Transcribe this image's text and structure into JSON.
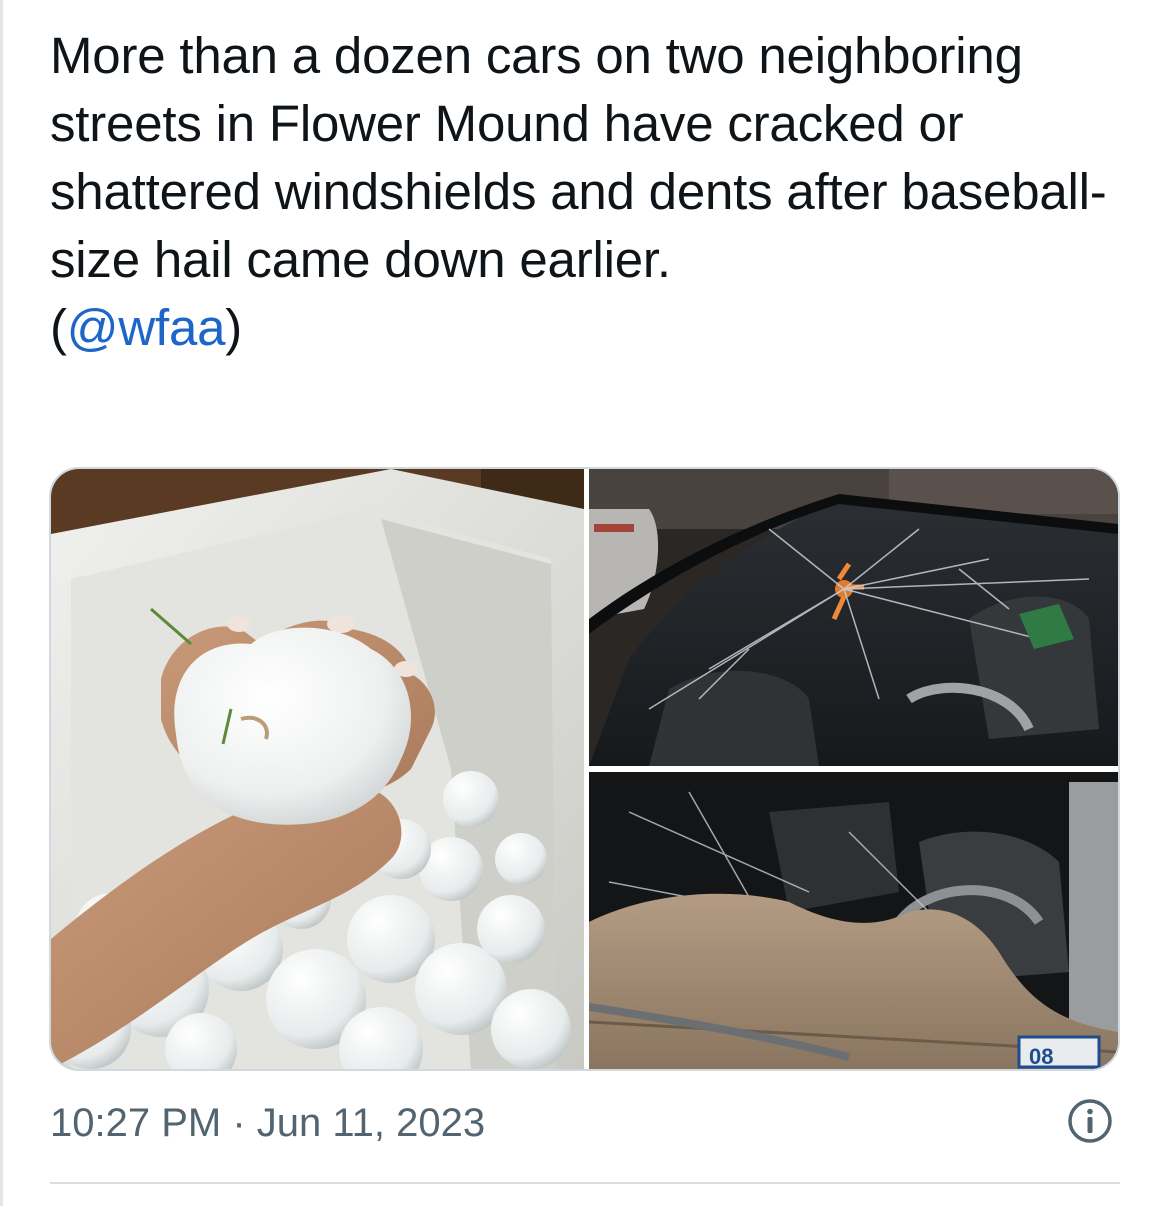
{
  "tweet": {
    "text": "More than a dozen cars on two neighboring streets in Flower Mound have cracked or shattered windshields and dents after baseball-size hail came down earlier.",
    "mention_open": "(",
    "mention": "@wfaa",
    "mention_close": ")"
  },
  "media": {
    "photos": [
      {
        "subject": "hand holding baseball-size hailstone over cooler of hail"
      },
      {
        "subject": "cracked car windshield"
      },
      {
        "subject": "shattered windshield with glass on dashboard"
      }
    ],
    "plate_fragment": "08"
  },
  "meta": {
    "time": "10:27 PM",
    "separator": " · ",
    "date": "Jun 11, 2023"
  },
  "icons": {
    "info": "info-circle-icon"
  },
  "colors": {
    "text": "#0f1419",
    "mention": "#1d65c9",
    "meta": "#536471",
    "border": "#cfd9de"
  }
}
